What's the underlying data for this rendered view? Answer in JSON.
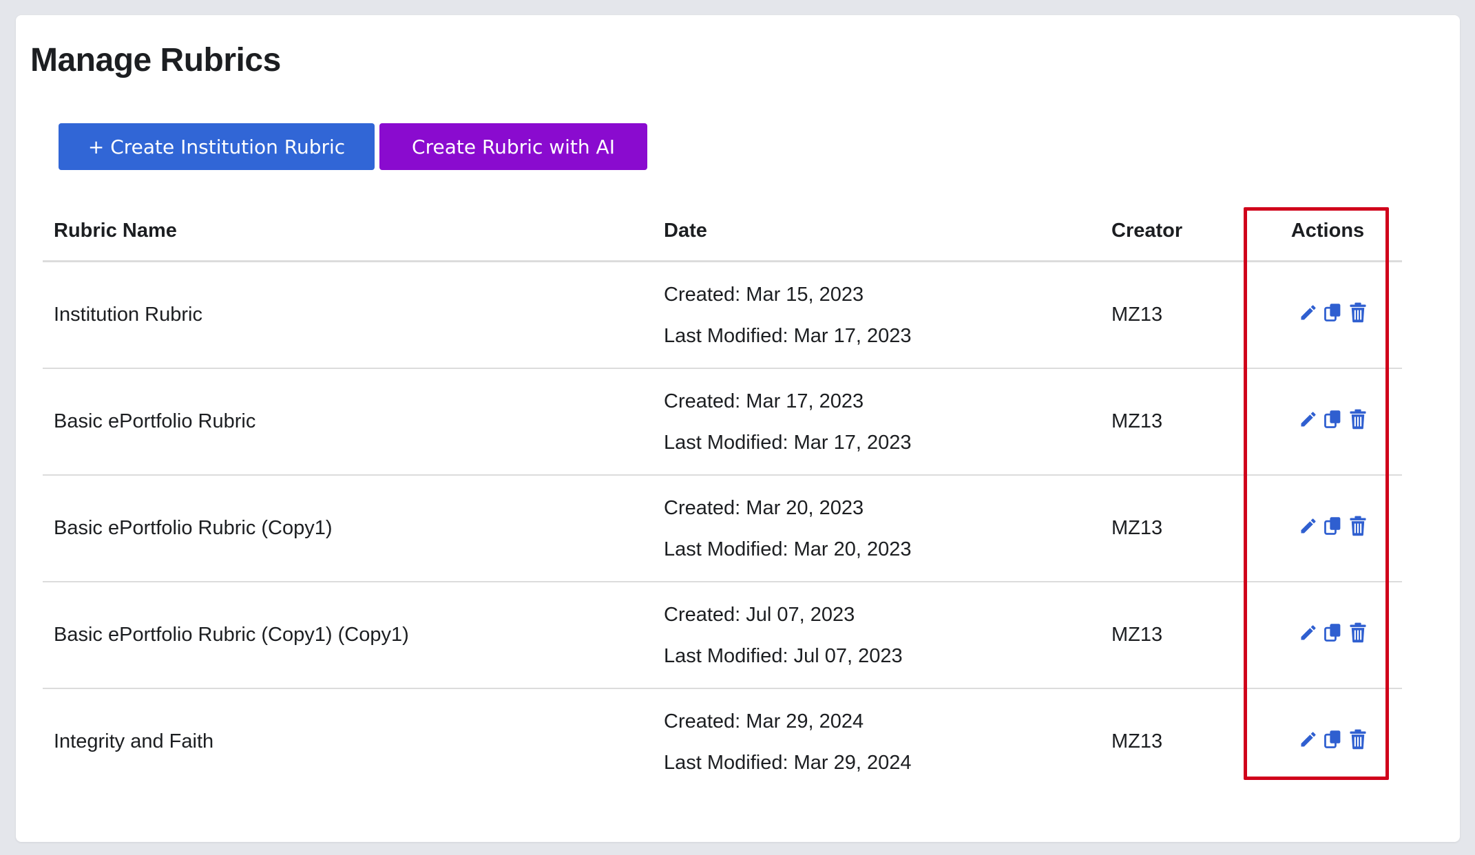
{
  "page": {
    "title": "Manage Rubrics"
  },
  "toolbar": {
    "create_institution_label": "+ Create Institution Rubric",
    "create_ai_label": "Create Rubric with AI"
  },
  "table": {
    "headers": {
      "name": "Rubric Name",
      "date": "Date",
      "creator": "Creator",
      "actions": "Actions"
    },
    "rows": [
      {
        "name": "Institution Rubric",
        "created": "Created: Mar 15, 2023",
        "modified": "Last Modified: Mar 17, 2023",
        "creator": "MZ13"
      },
      {
        "name": "Basic ePortfolio Rubric",
        "created": "Created: Mar 17, 2023",
        "modified": "Last Modified: Mar 17, 2023",
        "creator": "MZ13"
      },
      {
        "name": "Basic ePortfolio Rubric (Copy1)",
        "created": "Created: Mar 20, 2023",
        "modified": "Last Modified: Mar 20, 2023",
        "creator": "MZ13"
      },
      {
        "name": "Basic ePortfolio Rubric (Copy1) (Copy1)",
        "created": "Created: Jul 07, 2023",
        "modified": "Last Modified: Jul 07, 2023",
        "creator": "MZ13"
      },
      {
        "name": "Integrity and Faith",
        "created": "Created: Mar 29, 2024",
        "modified": "Last Modified: Mar 29, 2024",
        "creator": "MZ13"
      }
    ],
    "row_actions": [
      "pencil-icon",
      "copy-icon",
      "trash-icon"
    ]
  },
  "colors": {
    "primary_button": "#3166d6",
    "ai_button": "#8a0bcf",
    "action_icon": "#2f5fd0",
    "highlight_border": "#d0021b"
  }
}
